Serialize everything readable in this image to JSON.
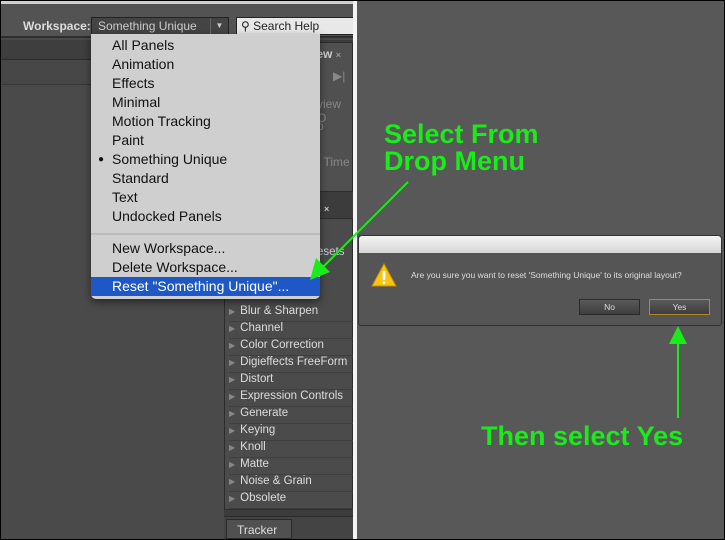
{
  "toolbar": {
    "workspace_label": "Workspace:",
    "workspace_value": "Something Unique",
    "search_placeholder": "Search Help"
  },
  "panels": {
    "preview_tab": "iew",
    "preview_close": "×",
    "view_options": "view O",
    "snap": "p",
    "time": "t Time",
    "effects_tab": "s",
    "effects_close": "×",
    "presets": "esets",
    "tracker_tab": "Tracker",
    "tracker_close": "×"
  },
  "effects": [
    "Blur & Sharpen",
    "Channel",
    "Color Correction",
    "Digieffects FreeForm",
    "Distort",
    "Expression Controls",
    "Generate",
    "Keying",
    "Knoll",
    "Matte",
    "Noise & Grain",
    "Obsolete"
  ],
  "menu": {
    "workspaces": [
      "All Panels",
      "Animation",
      "Effects",
      "Minimal",
      "Motion Tracking",
      "Paint",
      "Something Unique",
      "Standard",
      "Text",
      "Undocked Panels"
    ],
    "checked": "Something Unique",
    "actions": [
      "New Workspace...",
      "Delete Workspace...",
      "Reset \"Something Unique\"..."
    ],
    "highlighted": "Reset \"Something Unique\"..."
  },
  "dialog": {
    "message": "Are you sure you want to reset 'Something Unique' to its original layout?",
    "no_label": "No",
    "yes_label": "Yes",
    "icon": "warning-icon"
  },
  "annotations": {
    "step1_line1": "Select From",
    "step1_line2": "Drop Menu",
    "step2": "Then select Yes",
    "color": "#1bea1b"
  },
  "colors": {
    "highlight": "#1d58c6",
    "menu_bg": "#cfcfcf",
    "panel_bg": "#4a4a4a"
  }
}
